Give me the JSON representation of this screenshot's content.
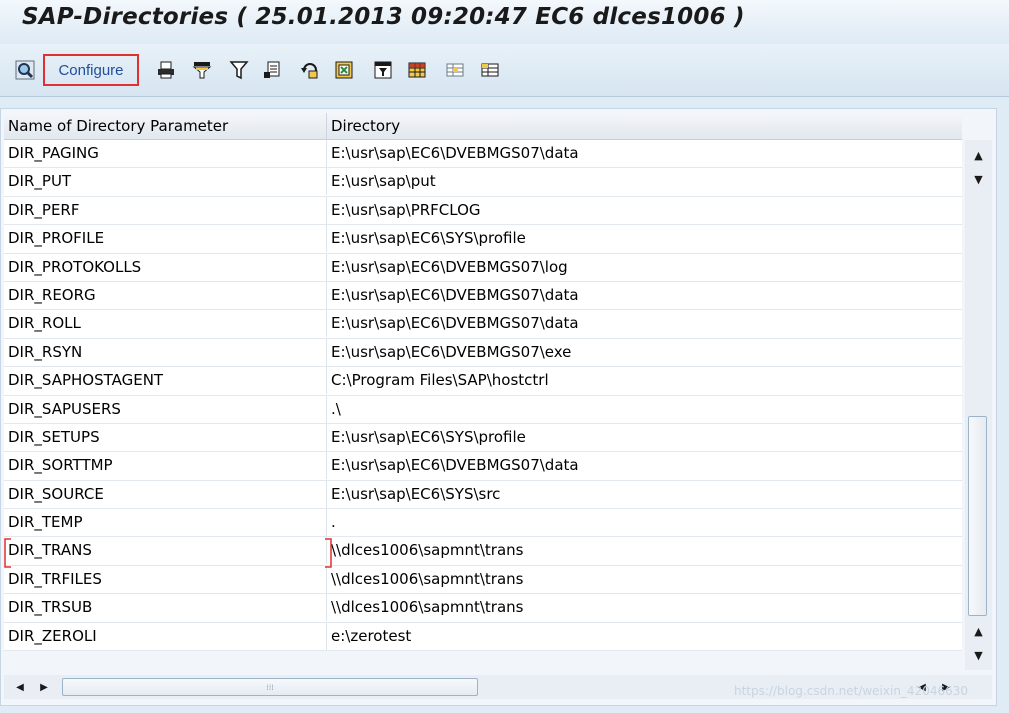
{
  "window": {
    "title": "SAP-Directories ( 25.01.2013 09:20:47 EC6 dlces1006 )"
  },
  "toolbar": {
    "configure_label": "Configure",
    "icons": [
      "details-icon",
      "print-icon",
      "sort-icon",
      "filter-icon",
      "export-icon",
      "refresh-icon",
      "spreadsheet-icon",
      "word-processing-icon",
      "layout-icon",
      "change-layout-icon",
      "select-layout-icon"
    ]
  },
  "table": {
    "columns": [
      "Name of Directory Parameter",
      "Directory"
    ],
    "rows": [
      [
        "DIR_PAGING",
        "E:\\usr\\sap\\EC6\\DVEBMGS07\\data"
      ],
      [
        "DIR_PUT",
        "E:\\usr\\sap\\put"
      ],
      [
        "DIR_PERF",
        "E:\\usr\\sap\\PRFCLOG"
      ],
      [
        "DIR_PROFILE",
        "E:\\usr\\sap\\EC6\\SYS\\profile"
      ],
      [
        "DIR_PROTOKOLLS",
        "E:\\usr\\sap\\EC6\\DVEBMGS07\\log"
      ],
      [
        "DIR_REORG",
        "E:\\usr\\sap\\EC6\\DVEBMGS07\\data"
      ],
      [
        "DIR_ROLL",
        "E:\\usr\\sap\\EC6\\DVEBMGS07\\data"
      ],
      [
        "DIR_RSYN",
        "E:\\usr\\sap\\EC6\\DVEBMGS07\\exe"
      ],
      [
        "DIR_SAPHOSTAGENT",
        "C:\\Program Files\\SAP\\hostctrl"
      ],
      [
        "DIR_SAPUSERS",
        ".\\"
      ],
      [
        "DIR_SETUPS",
        "E:\\usr\\sap\\EC6\\SYS\\profile"
      ],
      [
        "DIR_SORTTMP",
        "E:\\usr\\sap\\EC6\\DVEBMGS07\\data"
      ],
      [
        "DIR_SOURCE",
        "E:\\usr\\sap\\EC6\\SYS\\src"
      ],
      [
        "DIR_TEMP",
        "."
      ],
      [
        "DIR_TRANS",
        "\\\\dlces1006\\sapmnt\\trans"
      ],
      [
        "DIR_TRFILES",
        "\\\\dlces1006\\sapmnt\\trans"
      ],
      [
        "DIR_TRSUB",
        "\\\\dlces1006\\sapmnt\\trans"
      ],
      [
        "DIR_ZEROLI",
        "e:\\zerotest"
      ]
    ]
  },
  "watermark": "https://blog.csdn.net/weixin_42046630",
  "colors": {
    "accent": "#1f4e9c",
    "highlight": "#e03030",
    "background": "#dfebf5"
  }
}
